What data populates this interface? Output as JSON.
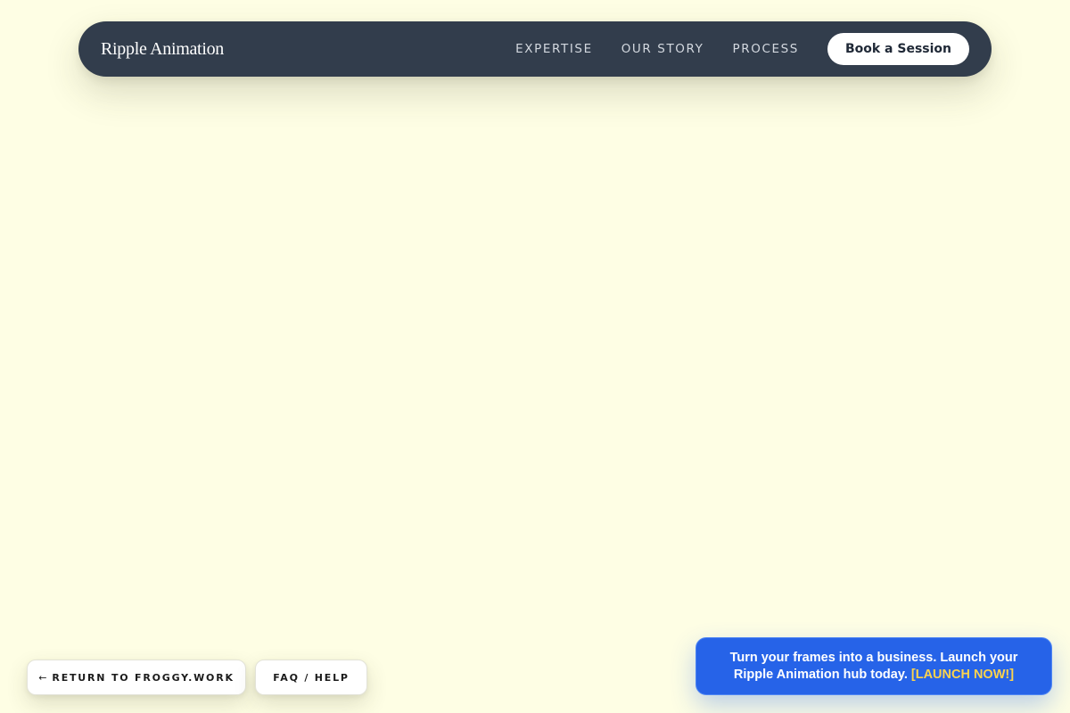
{
  "nav": {
    "brand": "Ripple Animation",
    "links": [
      "EXPERTISE",
      "OUR STORY",
      "PROCESS"
    ],
    "cta_label": "Book a Session"
  },
  "footer_buttons": {
    "return_arrow": "←",
    "return_label": "RETURN TO FROGGY.WORK",
    "faq_label": "FAQ / HELP"
  },
  "promo": {
    "text": "Turn your frames into a business. Launch your Ripple Animation hub today.",
    "cta_label": "[LAUNCH NOW!]"
  },
  "colors": {
    "page_background": "#fefee4",
    "nav_background": "#323d4c",
    "promo_background": "#2663e8",
    "promo_cta": "#fcd34d"
  }
}
